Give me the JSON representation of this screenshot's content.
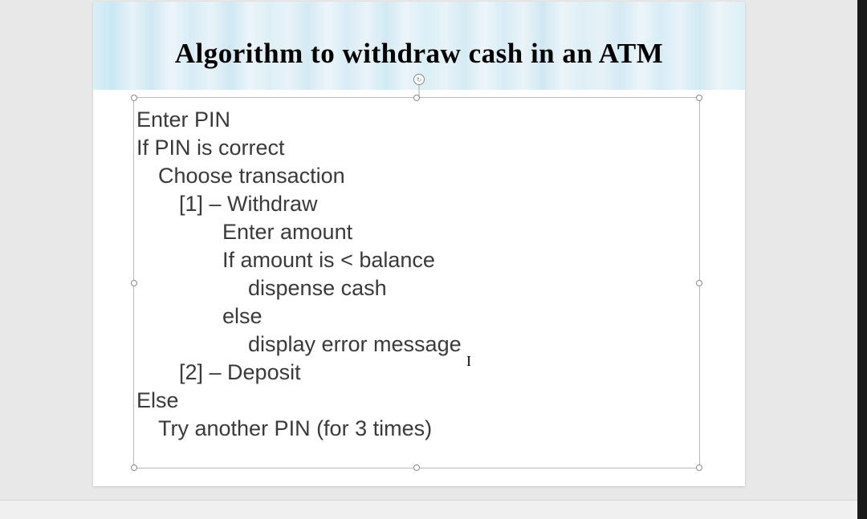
{
  "slide": {
    "title": "Algorithm to withdraw cash in an ATM",
    "lines": [
      {
        "indent": "i0",
        "text": "Enter PIN"
      },
      {
        "indent": "i0",
        "text": "If PIN is correct"
      },
      {
        "indent": "i1",
        "text": "Choose transaction"
      },
      {
        "indent": "i2",
        "text": "[1] – Withdraw"
      },
      {
        "indent": "i3",
        "text": "Enter amount"
      },
      {
        "indent": "i3",
        "text": "If amount is < balance"
      },
      {
        "indent": "i4",
        "text": "dispense cash"
      },
      {
        "indent": "i3",
        "text": "else"
      },
      {
        "indent": "i4",
        "text": "display error message"
      },
      {
        "indent": "i2",
        "text": "[2] – Deposit"
      },
      {
        "indent": "i0",
        "text": "Else"
      },
      {
        "indent": "i1",
        "text": "Try another PIN (for 3 times)"
      }
    ]
  }
}
